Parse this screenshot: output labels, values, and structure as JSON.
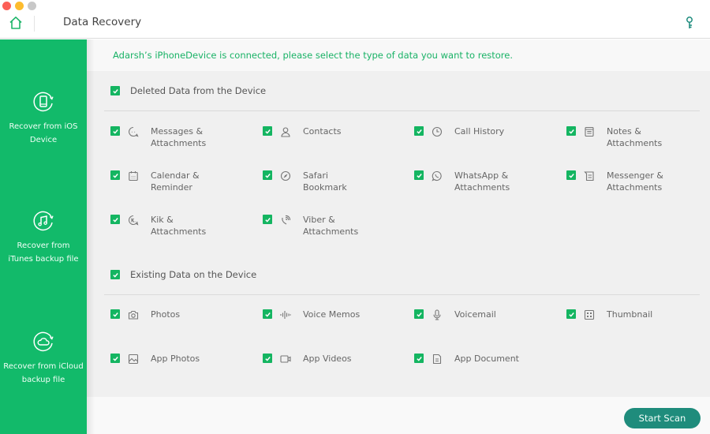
{
  "window": {
    "title": "Data Recovery",
    "traffic_lights": [
      "close",
      "minimize",
      "maximize"
    ]
  },
  "toolbar": {
    "home_icon": "home-icon",
    "key_icon": "key-icon"
  },
  "sidebar": {
    "items": [
      {
        "label": "Recover from iOS Device",
        "line1": "Recover from iOS",
        "line2": "Device",
        "icon": "phone-refresh-icon",
        "active": true
      },
      {
        "label": "Recover from iTunes backup file",
        "line1": "Recover from",
        "line2": "iTunes backup file",
        "icon": "music-refresh-icon"
      },
      {
        "label": "Recover from iCloud backup file",
        "line1": "Recover from iCloud",
        "line2": "backup file",
        "icon": "cloud-refresh-icon"
      }
    ]
  },
  "main": {
    "notice": "Adarsh’s iPhoneDevice is connected, please select the type of data you want to restore.",
    "sections": [
      {
        "title": "Deleted Data from the Device",
        "checked": true,
        "options": [
          {
            "label": "Messages & Attachments",
            "line1": "Messages &",
            "line2": "Attachments",
            "icon": "message-icon",
            "checked": true
          },
          {
            "label": "Contacts",
            "line1": "Contacts",
            "line2": "",
            "icon": "contact-icon",
            "checked": true
          },
          {
            "label": "Call History",
            "line1": "Call History",
            "line2": "",
            "icon": "clock-icon",
            "checked": true
          },
          {
            "label": "Notes & Attachments",
            "line1": "Notes &",
            "line2": "Attachments",
            "icon": "notes-icon",
            "checked": true
          },
          {
            "label": "Calendar & Reminder",
            "line1": "Calendar &",
            "line2": "Reminder",
            "icon": "calendar-icon",
            "checked": true
          },
          {
            "label": "Safari Bookmark",
            "line1": "Safari Bookmark",
            "line2": "",
            "icon": "compass-icon",
            "checked": true
          },
          {
            "label": "WhatsApp & Attachments",
            "line1": "WhatsApp &",
            "line2": "Attachments",
            "icon": "whatsapp-icon",
            "checked": true
          },
          {
            "label": "Messenger & Attachments",
            "line1": "Messenger &",
            "line2": "Attachments",
            "icon": "messenger-icon",
            "checked": true
          },
          {
            "label": "Kik & Attachments",
            "line1": "Kik & Attachments",
            "line2": "",
            "icon": "kik-icon",
            "checked": true
          },
          {
            "label": "Viber & Attachments",
            "line1": "Viber &",
            "line2": "Attachments",
            "icon": "viber-icon",
            "checked": true
          }
        ]
      },
      {
        "title": "Existing Data on the Device",
        "checked": true,
        "options": [
          {
            "label": "Photos",
            "line1": "Photos",
            "line2": "",
            "icon": "camera-icon",
            "checked": true
          },
          {
            "label": "Voice Memos",
            "line1": "Voice Memos",
            "line2": "",
            "icon": "waveform-icon",
            "checked": true
          },
          {
            "label": "Voicemail",
            "line1": "Voicemail",
            "line2": "",
            "icon": "microphone-icon",
            "checked": true
          },
          {
            "label": "Thumbnail",
            "line1": "Thumbnail",
            "line2": "",
            "icon": "thumbnail-grid-icon",
            "checked": true
          },
          {
            "label": "App Photos",
            "line1": "App Photos",
            "line2": "",
            "icon": "image-icon",
            "checked": true
          },
          {
            "label": "App Videos",
            "line1": "App Videos",
            "line2": "",
            "icon": "video-icon",
            "checked": true
          },
          {
            "label": "App Document",
            "line1": "App Document",
            "line2": "",
            "icon": "document-icon",
            "checked": true
          }
        ]
      }
    ],
    "start_button": "Start Scan"
  },
  "colors": {
    "sidebar_green": "#12ba6a",
    "checkbox_green": "#14b561",
    "notice_green": "#19b266",
    "button_teal": "#1f8c7c",
    "home_icon_green": "#1fb56a",
    "key_icon_teal": "#1b8a7c"
  }
}
